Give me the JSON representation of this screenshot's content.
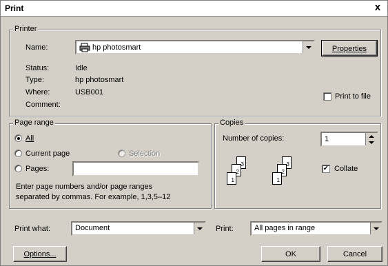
{
  "window": {
    "title": "Print",
    "close_glyph": "x"
  },
  "printer": {
    "group_label": "Printer",
    "name_label": "Name:",
    "name_value": "hp photosmart",
    "properties_label": "Properties",
    "status_label": "Status:",
    "status_value": "Idle",
    "type_label": "Type:",
    "type_value": "hp photosmart",
    "where_label": "Where:",
    "where_value": "USB001",
    "comment_label": "Comment:",
    "print_to_file_label": "Print to file"
  },
  "page_range": {
    "group_label": "Page range",
    "all_label": "All",
    "current_label": "Current page",
    "selection_label": "Selection",
    "pages_label": "Pages:",
    "pages_value": "",
    "hint": "Enter page numbers and/or page ranges",
    "hint2": "separated by commas.  For example, 1,3,5–12"
  },
  "copies": {
    "group_label": "Copies",
    "number_label": "Number of copies:",
    "number_value": "1",
    "collate_label": "Collate",
    "collate_checked": true,
    "page_numbers": [
      "1",
      "2",
      "3"
    ]
  },
  "bottom": {
    "print_what_label": "Print what:",
    "print_what_value": "Document",
    "print_label": "Print:",
    "print_value": "All pages in range",
    "options_label": "Options...",
    "ok_label": "OK",
    "cancel_label": "Cancel"
  },
  "icons": {
    "close": "close-icon",
    "printer": "printer-icon",
    "dropdown": "chevron-down-icon",
    "spin": "spinner-arrows-icon"
  }
}
